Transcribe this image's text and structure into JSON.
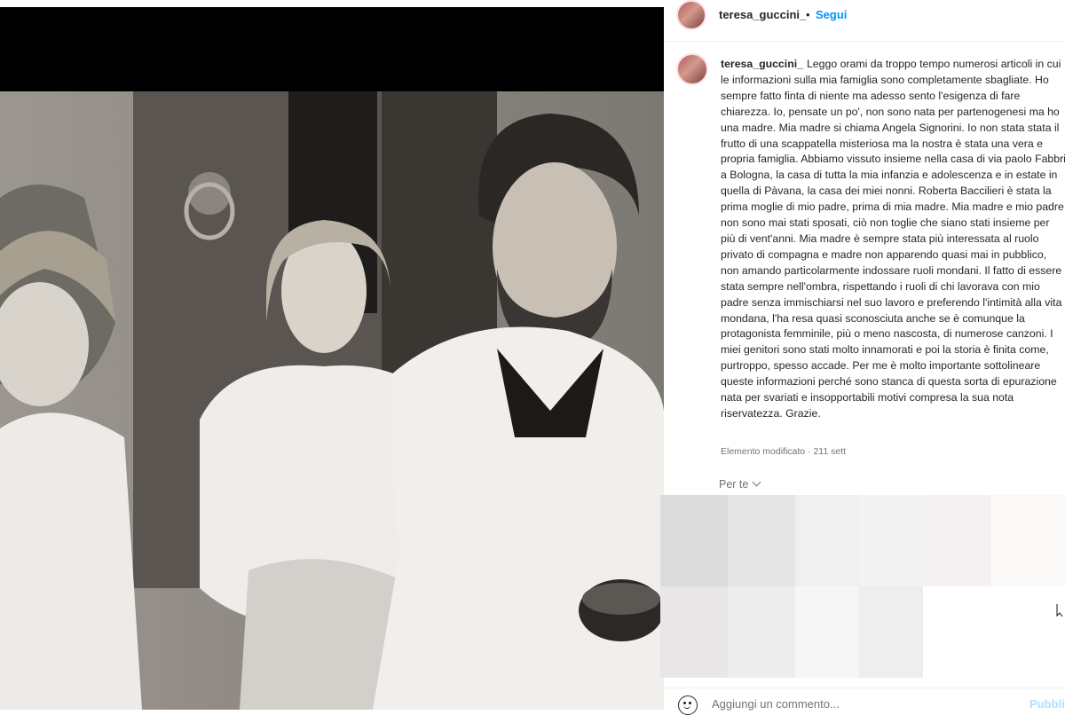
{
  "header": {
    "username": "teresa_guccini_",
    "separator": "•",
    "follow_label": "Segui",
    "avatar_icon": "profile-avatar"
  },
  "post": {
    "username": "teresa_guccini_",
    "caption": "Leggo orami da troppo tempo numerosi articoli in cui le informazioni sulla mia famiglia sono completamente sbagliate. Ho sempre fatto finta di niente ma adesso sento l'esigenza di fare chiarezza. Io, pensate un po', non sono nata per partenogenesi ma ho una madre. Mia madre si chiama Angela Signorini. Io non stata stata il frutto di una scappatella misteriosa ma la nostra è stata una vera e propria famiglia. Abbiamo vissuto insieme nella casa di via paolo Fabbri a Bologna, la casa di tutta la mia infanzia e adolescenza e in estate in quella di Pàvana, la casa dei miei nonni. Roberta Baccilieri è stata la prima moglie di mio padre, prima di mia madre. Mia madre e mio padre non sono mai stati sposati, ciò non toglie che siano stati insieme per più di vent'anni. Mia madre è sempre stata più interessata al ruolo privato di compagna e madre non apparendo quasi mai in pubblico, non amando particolarmente indossare ruoli mondani. Il fatto di essere stata sempre nell'ombra, rispettando i ruoli di chi lavorava con mio padre senza immischiarsi nel suo lavoro e preferendo l'intimità alla vita mondana, l'ha resa quasi sconosciuta anche se è comunque la protagonista femminile, più o meno nascosta, di numerose canzoni. I miei genitori sono stati molto innamorati e poi la storia è finita come, purtroppo, spesso accade. Per me è molto importante sottolineare queste informazioni perché sono stanca di questa sorta di epurazione nata per svariati e insopportabili motivi compresa la sua nota riservatezza. Grazie.",
    "meta": "Elemento modificato · 211 sett"
  },
  "for_you": {
    "label": "Per te",
    "icon": "chevron-down-icon"
  },
  "thumbnails": {
    "colors": [
      "#dcdcdc",
      "#e5e5e5",
      "#f0f0f0",
      "#f3f3f3",
      "#f5f0f1",
      "#fbf8f8",
      "#e9e6e8",
      "#ededed",
      "#f6f6f6",
      "#eeeeee",
      "#ffffff",
      "#ffffff"
    ]
  },
  "comment": {
    "placeholder": "Aggiungi un commento...",
    "publish_label": "Pubblica",
    "emoji_icon": "smiley-icon"
  }
}
